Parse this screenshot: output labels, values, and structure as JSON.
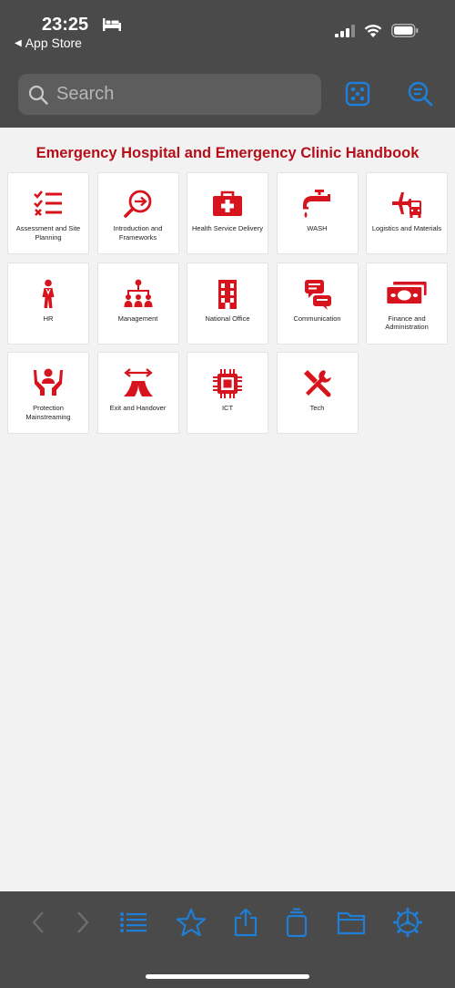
{
  "status_bar": {
    "time": "23:25",
    "back_label": "App Store"
  },
  "search": {
    "placeholder": "Search"
  },
  "handbook_title": "Emergency Hospital and Emergency Clinic Handbook",
  "tiles": [
    {
      "label": "Assessment and Site Planning",
      "icon": "checklist-icon"
    },
    {
      "label": "Introduction and Frameworks",
      "icon": "search-arrow-icon"
    },
    {
      "label": "Health Service Delivery",
      "icon": "medical-kit-icon"
    },
    {
      "label": "WASH",
      "icon": "water-tap-icon"
    },
    {
      "label": "Logistics and Materials",
      "icon": "plane-truck-icon"
    },
    {
      "label": "HR",
      "icon": "person-icon"
    },
    {
      "label": "Management",
      "icon": "org-chart-icon"
    },
    {
      "label": "National Office",
      "icon": "building-icon"
    },
    {
      "label": "Communication",
      "icon": "chat-bubbles-icon"
    },
    {
      "label": "Finance and Administration",
      "icon": "money-icon"
    },
    {
      "label": "Protection Mainstreaming",
      "icon": "protection-hands-icon"
    },
    {
      "label": "Exit and Handover",
      "icon": "tent-exit-icon"
    },
    {
      "label": "ICT",
      "icon": "chip-icon"
    },
    {
      "label": "Tech",
      "icon": "tools-icon"
    }
  ],
  "toolbar_icons": [
    "back-icon",
    "forward-icon",
    "list-icon",
    "star-icon",
    "share-icon",
    "copy-icon",
    "folder-icon",
    "settings-icon"
  ],
  "colors": {
    "accent_red": "#d7141d",
    "title_red": "#b50f1a",
    "ios_blue": "#1e7fd8",
    "chrome_gray": "#4a4a4a"
  }
}
